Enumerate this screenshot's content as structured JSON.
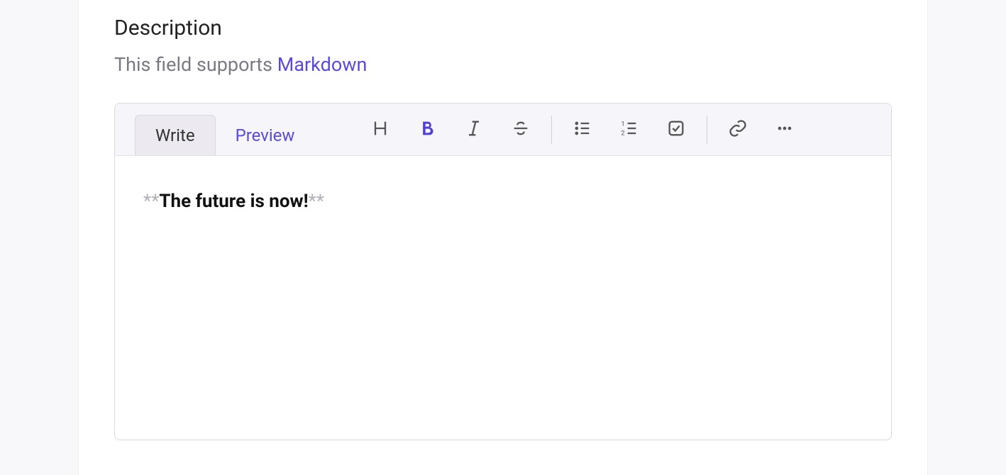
{
  "field": {
    "label": "Description",
    "help_prefix": "This field supports ",
    "help_link": "Markdown"
  },
  "tabs": {
    "write": "Write",
    "preview": "Preview"
  },
  "content": {
    "stars": "**",
    "text": "The future is now!",
    "stars_end": "**"
  }
}
